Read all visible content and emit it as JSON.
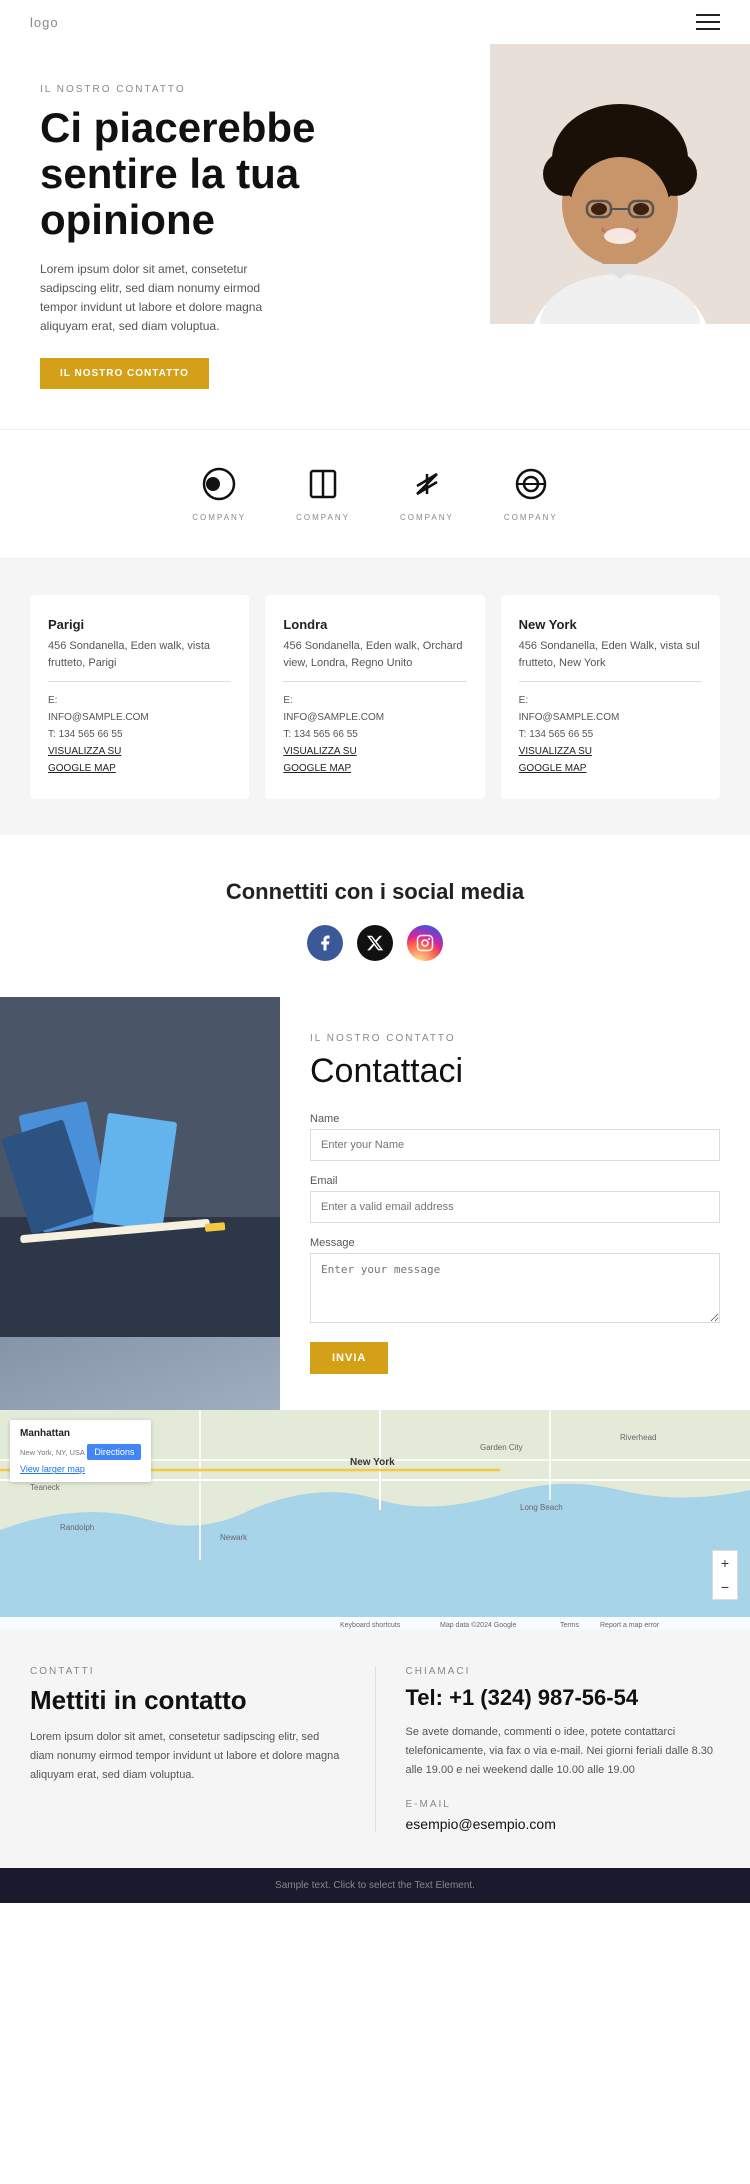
{
  "header": {
    "logo": "logo",
    "menu_icon": "☰"
  },
  "hero": {
    "label": "IL NOSTRO CONTATTO",
    "title": "Ci piacerebbe sentire la tua opinione",
    "description": "Lorem ipsum dolor sit amet, consetetur sadipscing elitr, sed diam nonumy eirmod tempor invidunt ut labore et dolore magna aliquyam erat, sed diam voluptua.",
    "button": "IL NOSTRO CONTATTO"
  },
  "logos": [
    {
      "id": "logo1",
      "name": "COMPANY",
      "icon": "⊙"
    },
    {
      "id": "logo2",
      "name": "COMPANY",
      "icon": "⊡"
    },
    {
      "id": "logo3",
      "name": "COMPANY",
      "icon": "⩕"
    },
    {
      "id": "logo4",
      "name": "COMPANY",
      "icon": "⊘"
    }
  ],
  "offices": [
    {
      "city": "Parigi",
      "address": "456 Sondanella, Eden walk, vista frutteto, Parigi",
      "email_label": "E:",
      "email": "INFO@SAMPLE.COM",
      "phone_label": "T:",
      "phone": "134 565 66 55",
      "map_link": "VISUALIZZA SU\nGOOGLE MAP"
    },
    {
      "city": "Londra",
      "address": "456 Sondanella, Eden walk, Orchard view, Londra, Regno Unito",
      "email_label": "E:",
      "email": "INFO@SAMPLE.COM",
      "phone_label": "T:",
      "phone": "134 565 66 55",
      "map_link": "VISUALIZZA SU\nGOOGLE MAP"
    },
    {
      "city": "New York",
      "address": "456 Sondanella, Eden Walk, vista sul frutteto, New York",
      "email_label": "E:",
      "email": "INFO@SAMPLE.COM",
      "phone_label": "T:",
      "phone": "134 565 66 55",
      "map_link": "VISUALIZZA SU\nGOOGLE MAP"
    }
  ],
  "social": {
    "title": "Connettiti con i social media",
    "icons": [
      "facebook",
      "x-twitter",
      "instagram"
    ]
  },
  "contact_form": {
    "label": "IL NOSTRO CONTATTO",
    "title": "Contattaci",
    "name_label": "Name",
    "name_placeholder": "Enter your Name",
    "email_label": "Email",
    "email_placeholder": "Enter a valid email address",
    "message_label": "Message",
    "message_placeholder": "Enter your message",
    "button": "INVIA"
  },
  "map": {
    "location": "Manhattan",
    "address": "New York, NY, USA",
    "directions": "Directions",
    "view_link": "View larger map",
    "zoom_in": "+",
    "zoom_out": "−"
  },
  "bottom_info": {
    "left": {
      "label": "CONTATTI",
      "title": "Mettiti in contatto",
      "description": "Lorem ipsum dolor sit amet, consetetur sadipscing elitr, sed diam nonumy eirmod tempor invidunt ut labore et dolore magna aliquyam erat, sed diam voluptua."
    },
    "right": {
      "label": "CHIAMACI",
      "phone": "Tel: +1 (324) 987-56-54",
      "call_description": "Se avete domande, commenti o idee, potete contattarci telefonicamente, via fax o via e-mail. Nei giorni feriali dalle 8.30 alle 19.00 e nei weekend dalle 10.00 alle 19.00",
      "email_label": "E-MAIL",
      "email": "esempio@esempio.com"
    }
  },
  "footer": {
    "text": "Sample text. Click to select the Text Element."
  }
}
